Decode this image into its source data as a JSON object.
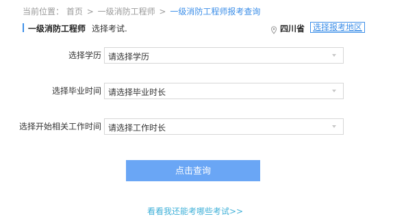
{
  "breadcrumb": {
    "prefix": "当前位置：",
    "items": [
      "首页",
      "一级消防工程师",
      "一级消防工程师报考查询"
    ],
    "separator": ">"
  },
  "header": {
    "title": "一级消防工程师",
    "subtitle": "选择考试.",
    "province": "四川省",
    "change_region": "选择报考地区"
  },
  "form": {
    "fields": [
      {
        "label": "选择学历",
        "value": "请选择学历"
      },
      {
        "label": "选择毕业时间",
        "value": "请选择毕业时长"
      },
      {
        "label": "选择开始相关工作时间",
        "value": "请选择工作时长"
      }
    ],
    "submit_label": "点击查询"
  },
  "footer": {
    "more_link": "看看我还能考哪些考试>>"
  },
  "colors": {
    "accent": "#3b8ee8",
    "button": "#6aa6f5",
    "link": "#3fb0d8"
  }
}
